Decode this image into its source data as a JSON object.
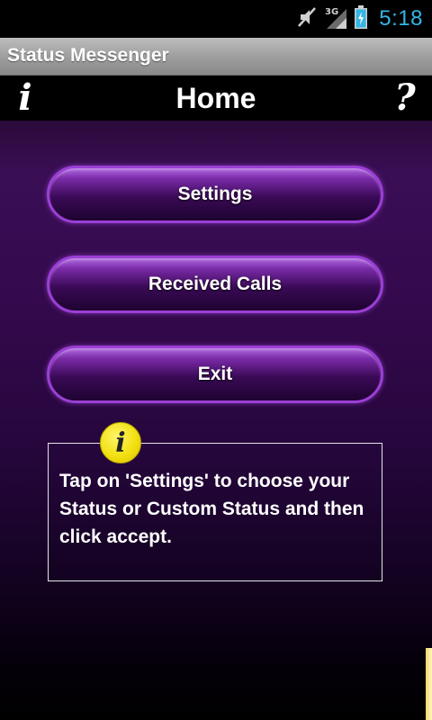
{
  "status_bar": {
    "time": "5:18",
    "network_label": "3G",
    "icons": [
      "mute-icon",
      "signal-icon",
      "battery-charging-icon"
    ]
  },
  "app": {
    "title": "Status Messenger"
  },
  "header": {
    "title": "Home",
    "info_glyph": "i",
    "help_glyph": "?"
  },
  "buttons": {
    "settings": "Settings",
    "received_calls": "Received Calls",
    "exit": "Exit"
  },
  "info_box": {
    "badge_glyph": "i",
    "text": "Tap on 'Settings' to choose your Status or Custom Status and then click accept."
  },
  "colors": {
    "clock": "#33b5e5",
    "button_border": "#9b3fd6",
    "badge": "#f2e012"
  }
}
